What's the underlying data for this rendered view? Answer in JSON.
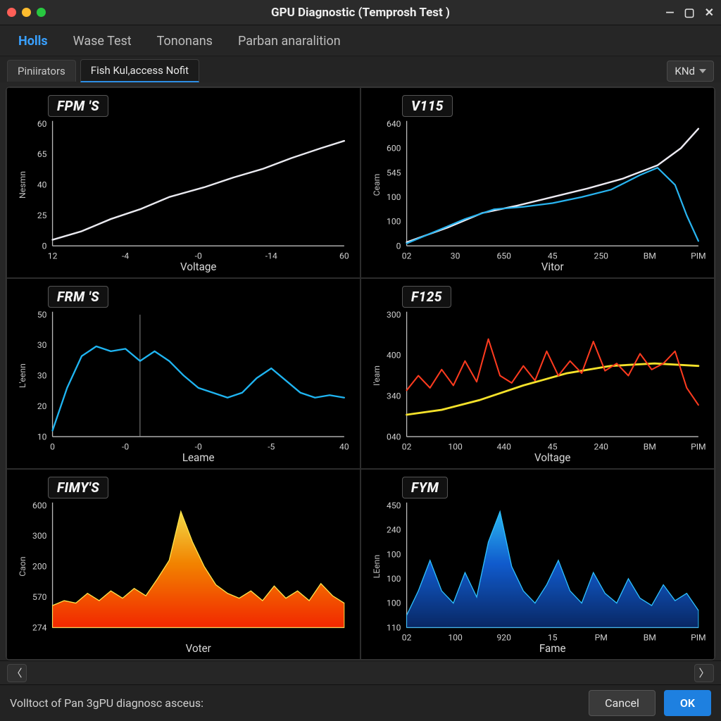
{
  "window": {
    "title": "GPU Diagnostic (Temprosh Test )"
  },
  "main_tabs": [
    {
      "label": "Holls",
      "active": true
    },
    {
      "label": "Wase Test",
      "active": false
    },
    {
      "label": "Tononans",
      "active": false
    },
    {
      "label": "Parban anaralition",
      "active": false
    }
  ],
  "sub_tabs": [
    {
      "label": "Piniirators",
      "active": false
    },
    {
      "label": "Fish Kul,access Nofit",
      "active": true
    }
  ],
  "dropdown": {
    "label": "KNd"
  },
  "footer": {
    "status": "Volltoct of Pan 3gPU diagnosc asceus:",
    "cancel": "Cancel",
    "ok": "OK"
  },
  "chart_data": [
    {
      "id": "fpm_s",
      "type": "line",
      "title": "FPM 'S",
      "xlabel": "Voltage",
      "ytitle": "Nesmn",
      "x_ticks": [
        "12",
        "-4",
        "-0",
        "-14",
        "60"
      ],
      "y_ticks": [
        "0",
        "25",
        "40",
        "65",
        "60"
      ],
      "series": [
        {
          "name": "white",
          "color": "#e9e9ef",
          "w": 2.4,
          "x": [
            0,
            0.1,
            0.2,
            0.3,
            0.4,
            0.52,
            0.62,
            0.72,
            0.82,
            0.92,
            1.0
          ],
          "y": [
            0.05,
            0.12,
            0.22,
            0.3,
            0.4,
            0.48,
            0.56,
            0.63,
            0.72,
            0.8,
            0.86
          ]
        }
      ]
    },
    {
      "id": "v15",
      "type": "line",
      "title": "V115",
      "xlabel": "Vitor",
      "ytitle": "Ceam",
      "x_ticks": [
        "02",
        "30",
        "650",
        "45",
        "250",
        "BM",
        "PIM"
      ],
      "y_ticks": [
        "0",
        "100",
        "100",
        "545",
        "600",
        "640"
      ],
      "series": [
        {
          "name": "white",
          "color": "#eceaf2",
          "w": 2.4,
          "x": [
            0,
            0.14,
            0.26,
            0.38,
            0.5,
            0.62,
            0.74,
            0.86,
            0.94,
            1.0
          ],
          "y": [
            0.03,
            0.15,
            0.27,
            0.33,
            0.4,
            0.47,
            0.55,
            0.66,
            0.8,
            0.96
          ]
        },
        {
          "name": "blue",
          "color": "#28b4f0",
          "w": 2.2,
          "x": [
            0,
            0.1,
            0.2,
            0.3,
            0.4,
            0.5,
            0.6,
            0.7,
            0.8,
            0.86,
            0.92,
            0.96,
            1.0
          ],
          "y": [
            0.02,
            0.12,
            0.22,
            0.3,
            0.32,
            0.35,
            0.4,
            0.46,
            0.58,
            0.64,
            0.5,
            0.25,
            0.04
          ]
        }
      ]
    },
    {
      "id": "frm_s",
      "type": "line",
      "title": "FRM 'S",
      "xlabel": "Leame",
      "ytitle": "L'eenn",
      "x_ticks": [
        "0",
        "-0",
        "-0",
        "-5",
        "40"
      ],
      "y_ticks": [
        "10",
        "20",
        "30",
        "30",
        "50"
      ],
      "marker_x": 0.3,
      "series": [
        {
          "name": "blue",
          "color": "#1fb5f2",
          "w": 2.3,
          "x": [
            0,
            0.05,
            0.1,
            0.15,
            0.2,
            0.25,
            0.3,
            0.35,
            0.4,
            0.45,
            0.5,
            0.55,
            0.6,
            0.65,
            0.7,
            0.75,
            0.8,
            0.85,
            0.9,
            0.95,
            1.0
          ],
          "y": [
            0.05,
            0.4,
            0.66,
            0.74,
            0.7,
            0.72,
            0.62,
            0.7,
            0.62,
            0.5,
            0.4,
            0.36,
            0.32,
            0.36,
            0.48,
            0.56,
            0.46,
            0.36,
            0.32,
            0.34,
            0.32
          ]
        }
      ]
    },
    {
      "id": "f125",
      "type": "line",
      "title": "F125",
      "xlabel": "Voltage",
      "ytitle": "I'eam",
      "x_ticks": [
        "02",
        "100",
        "440",
        "45",
        "240",
        "BM",
        "PIM"
      ],
      "y_ticks": [
        "040",
        "340",
        "400",
        "300"
      ],
      "series": [
        {
          "name": "yellow",
          "color": "#f4e12a",
          "w": 2.8,
          "x": [
            0,
            0.12,
            0.25,
            0.4,
            0.55,
            0.7,
            0.85,
            1.0
          ],
          "y": [
            0.18,
            0.22,
            0.3,
            0.42,
            0.52,
            0.58,
            0.6,
            0.58
          ]
        },
        {
          "name": "red",
          "color": "#ff3b1f",
          "w": 2.0,
          "x": [
            0,
            0.04,
            0.08,
            0.12,
            0.16,
            0.2,
            0.24,
            0.28,
            0.32,
            0.36,
            0.4,
            0.44,
            0.48,
            0.52,
            0.56,
            0.6,
            0.64,
            0.68,
            0.72,
            0.76,
            0.8,
            0.84,
            0.88,
            0.92,
            0.96,
            1.0
          ],
          "y": [
            0.38,
            0.5,
            0.4,
            0.55,
            0.42,
            0.62,
            0.45,
            0.8,
            0.5,
            0.44,
            0.58,
            0.46,
            0.7,
            0.5,
            0.62,
            0.52,
            0.78,
            0.54,
            0.6,
            0.5,
            0.68,
            0.55,
            0.6,
            0.7,
            0.4,
            0.26
          ]
        }
      ]
    },
    {
      "id": "fimy_s",
      "type": "area",
      "title": "FIMY'S",
      "xlabel": "Voter",
      "ytitle": "Caon",
      "x_ticks": [],
      "y_ticks": [
        "274",
        "570",
        "200",
        "300",
        "600"
      ],
      "flame": {
        "colors": [
          "#ff2a00",
          "#ff8a00",
          "#ffe44a"
        ],
        "x": [
          0,
          0.04,
          0.08,
          0.12,
          0.16,
          0.2,
          0.24,
          0.28,
          0.32,
          0.36,
          0.4,
          0.44,
          0.48,
          0.52,
          0.56,
          0.6,
          0.64,
          0.68,
          0.72,
          0.76,
          0.8,
          0.84,
          0.88,
          0.92,
          0.96,
          1.0
        ],
        "y": [
          0.18,
          0.22,
          0.2,
          0.28,
          0.22,
          0.3,
          0.24,
          0.32,
          0.26,
          0.4,
          0.55,
          0.95,
          0.7,
          0.5,
          0.35,
          0.28,
          0.24,
          0.3,
          0.22,
          0.34,
          0.24,
          0.3,
          0.22,
          0.36,
          0.26,
          0.2
        ]
      }
    },
    {
      "id": "fym",
      "type": "area",
      "title": "FYM",
      "xlabel": "Fame",
      "ytitle": "LEenn",
      "x_ticks": [
        "02",
        "100",
        "920",
        "15",
        "PM",
        "BM",
        "PIM"
      ],
      "y_ticks": [
        "110",
        "100",
        "100",
        "100",
        "240",
        "450"
      ],
      "flame": {
        "colors": [
          "#0a2a6a",
          "#1160d8",
          "#2ec0ff"
        ],
        "x": [
          0,
          0.04,
          0.08,
          0.12,
          0.16,
          0.2,
          0.24,
          0.28,
          0.32,
          0.36,
          0.4,
          0.44,
          0.48,
          0.52,
          0.56,
          0.6,
          0.64,
          0.68,
          0.72,
          0.76,
          0.8,
          0.84,
          0.88,
          0.92,
          0.96,
          1.0
        ],
        "y": [
          0.1,
          0.3,
          0.55,
          0.3,
          0.2,
          0.45,
          0.25,
          0.7,
          0.95,
          0.5,
          0.3,
          0.2,
          0.35,
          0.55,
          0.3,
          0.2,
          0.45,
          0.28,
          0.2,
          0.4,
          0.24,
          0.18,
          0.35,
          0.22,
          0.28,
          0.14
        ]
      }
    }
  ]
}
